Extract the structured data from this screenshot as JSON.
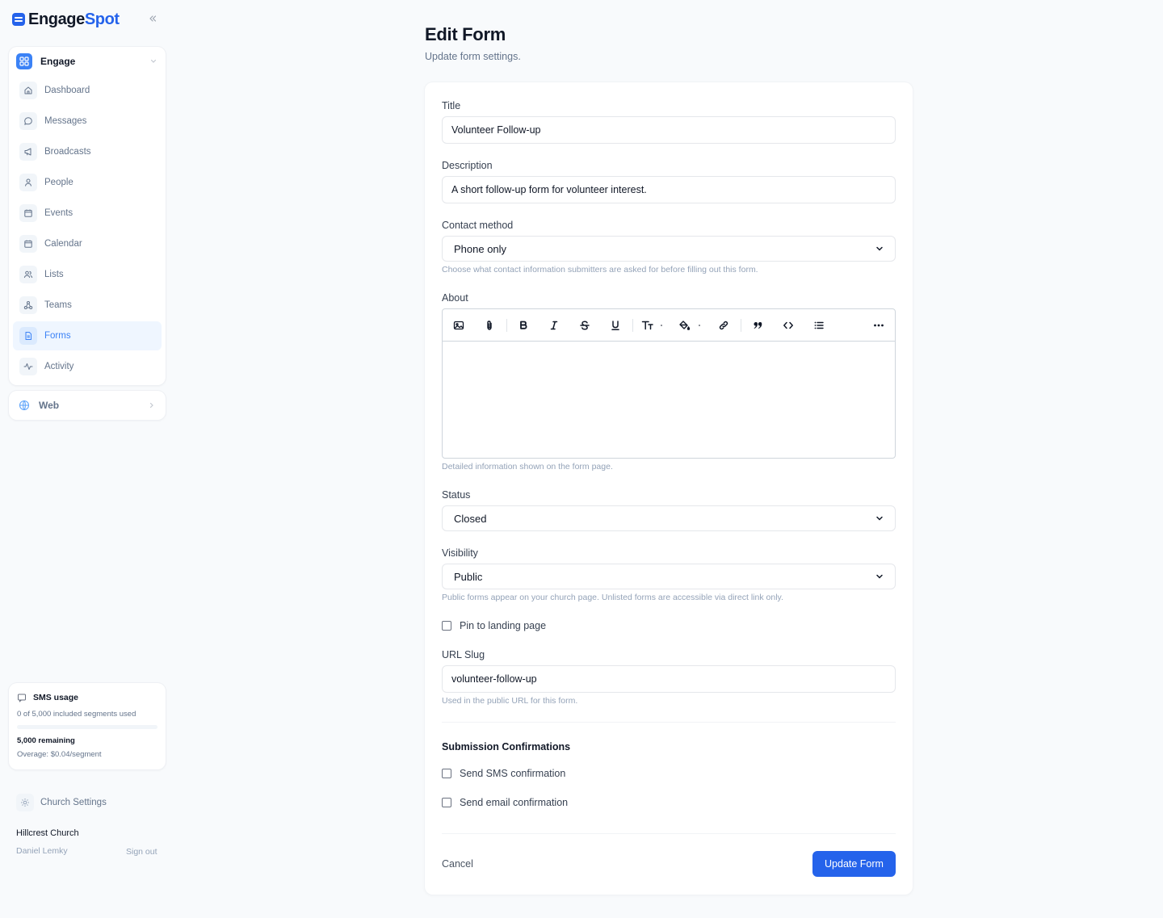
{
  "brand": {
    "name_part1": "Engage",
    "name_part2": "Spot",
    "accent": "#2563eb"
  },
  "sidebar": {
    "collapse_icon": "chevrons-left-icon",
    "engage_section": {
      "title": "Engage",
      "icon": "grid-icon",
      "expanded": true,
      "items": [
        {
          "label": "Dashboard",
          "icon": "home-icon",
          "active": false
        },
        {
          "label": "Messages",
          "icon": "chat-icon",
          "active": false
        },
        {
          "label": "Broadcasts",
          "icon": "megaphone-icon",
          "active": false
        },
        {
          "label": "People",
          "icon": "user-icon",
          "active": false
        },
        {
          "label": "Events",
          "icon": "calendar-icon",
          "active": false
        },
        {
          "label": "Calendar",
          "icon": "calendar-icon",
          "active": false
        },
        {
          "label": "Lists",
          "icon": "users-icon",
          "active": false
        },
        {
          "label": "Teams",
          "icon": "team-icon",
          "active": false
        },
        {
          "label": "Forms",
          "icon": "document-icon",
          "active": true
        },
        {
          "label": "Activity",
          "icon": "activity-icon",
          "active": false
        }
      ]
    },
    "web_section": {
      "title": "Web",
      "icon": "globe-icon"
    },
    "sms_usage": {
      "title": "SMS usage",
      "used_text": "0 of 5,000 included segments used",
      "used_fraction": 0,
      "remaining": "5,000 remaining",
      "overage": "Overage: $0.04/segment"
    },
    "church_settings": {
      "label": "Church Settings",
      "icon": "gear-icon"
    },
    "org_name": "Hillcrest Church",
    "user_name": "Daniel Lemky",
    "sign_out": "Sign out"
  },
  "page": {
    "title": "Edit Form",
    "subtitle": "Update form settings."
  },
  "form": {
    "title": {
      "label": "Title",
      "value": "Volunteer Follow-up"
    },
    "description": {
      "label": "Description",
      "value": "A short follow-up form for volunteer interest."
    },
    "contact_method": {
      "label": "Contact method",
      "value": "Phone only",
      "help": "Choose what contact information submitters are asked for before filling out this form."
    },
    "about": {
      "label": "About",
      "help": "Detailed information shown on the form page.",
      "toolbar": [
        "image-icon",
        "attachment-icon",
        "bold-icon",
        "italic-icon",
        "strikethrough-icon",
        "underline-icon",
        "text-size-icon",
        "fill-color-icon",
        "link-icon",
        "quote-icon",
        "code-icon",
        "bullet-list-icon",
        "more-icon"
      ]
    },
    "status": {
      "label": "Status",
      "value": "Closed"
    },
    "visibility": {
      "label": "Visibility",
      "value": "Public",
      "help": "Public forms appear on your church page. Unlisted forms are accessible via direct link only."
    },
    "pin": {
      "label": "Pin to landing page",
      "checked": false
    },
    "slug": {
      "label": "URL Slug",
      "value": "volunteer-follow-up",
      "help": "Used in the public URL for this form."
    },
    "confirmations": {
      "heading": "Submission Confirmations",
      "sms": {
        "label": "Send SMS confirmation",
        "checked": false
      },
      "email": {
        "label": "Send email confirmation",
        "checked": false
      }
    },
    "cancel_label": "Cancel",
    "submit_label": "Update Form"
  }
}
